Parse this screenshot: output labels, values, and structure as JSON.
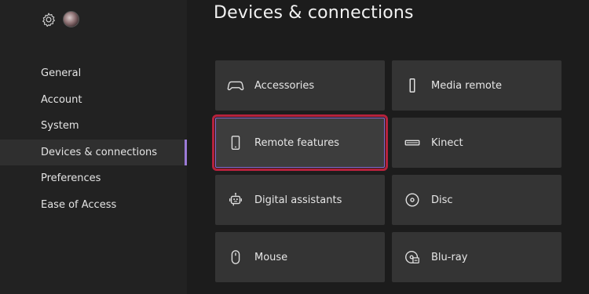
{
  "page": {
    "title": "Devices & connections"
  },
  "sidebar": {
    "items": [
      {
        "label": "General"
      },
      {
        "label": "Account"
      },
      {
        "label": "System"
      },
      {
        "label": "Devices & connections",
        "selected": true
      },
      {
        "label": "Preferences"
      },
      {
        "label": "Ease of Access"
      }
    ]
  },
  "tiles": [
    {
      "label": "Accessories",
      "icon": "controller-icon"
    },
    {
      "label": "Media remote",
      "icon": "remote-icon"
    },
    {
      "label": "Remote features",
      "icon": "phone-icon",
      "focused": true
    },
    {
      "label": "Kinect",
      "icon": "kinect-icon"
    },
    {
      "label": "Digital assistants",
      "icon": "assistant-icon"
    },
    {
      "label": "Disc",
      "icon": "disc-icon"
    },
    {
      "label": "Mouse",
      "icon": "mouse-icon"
    },
    {
      "label": "Blu-ray",
      "icon": "bluray-icon"
    }
  ],
  "colors": {
    "selection_accent": "#9b7ad6",
    "focus_outline": "#b5223c"
  }
}
